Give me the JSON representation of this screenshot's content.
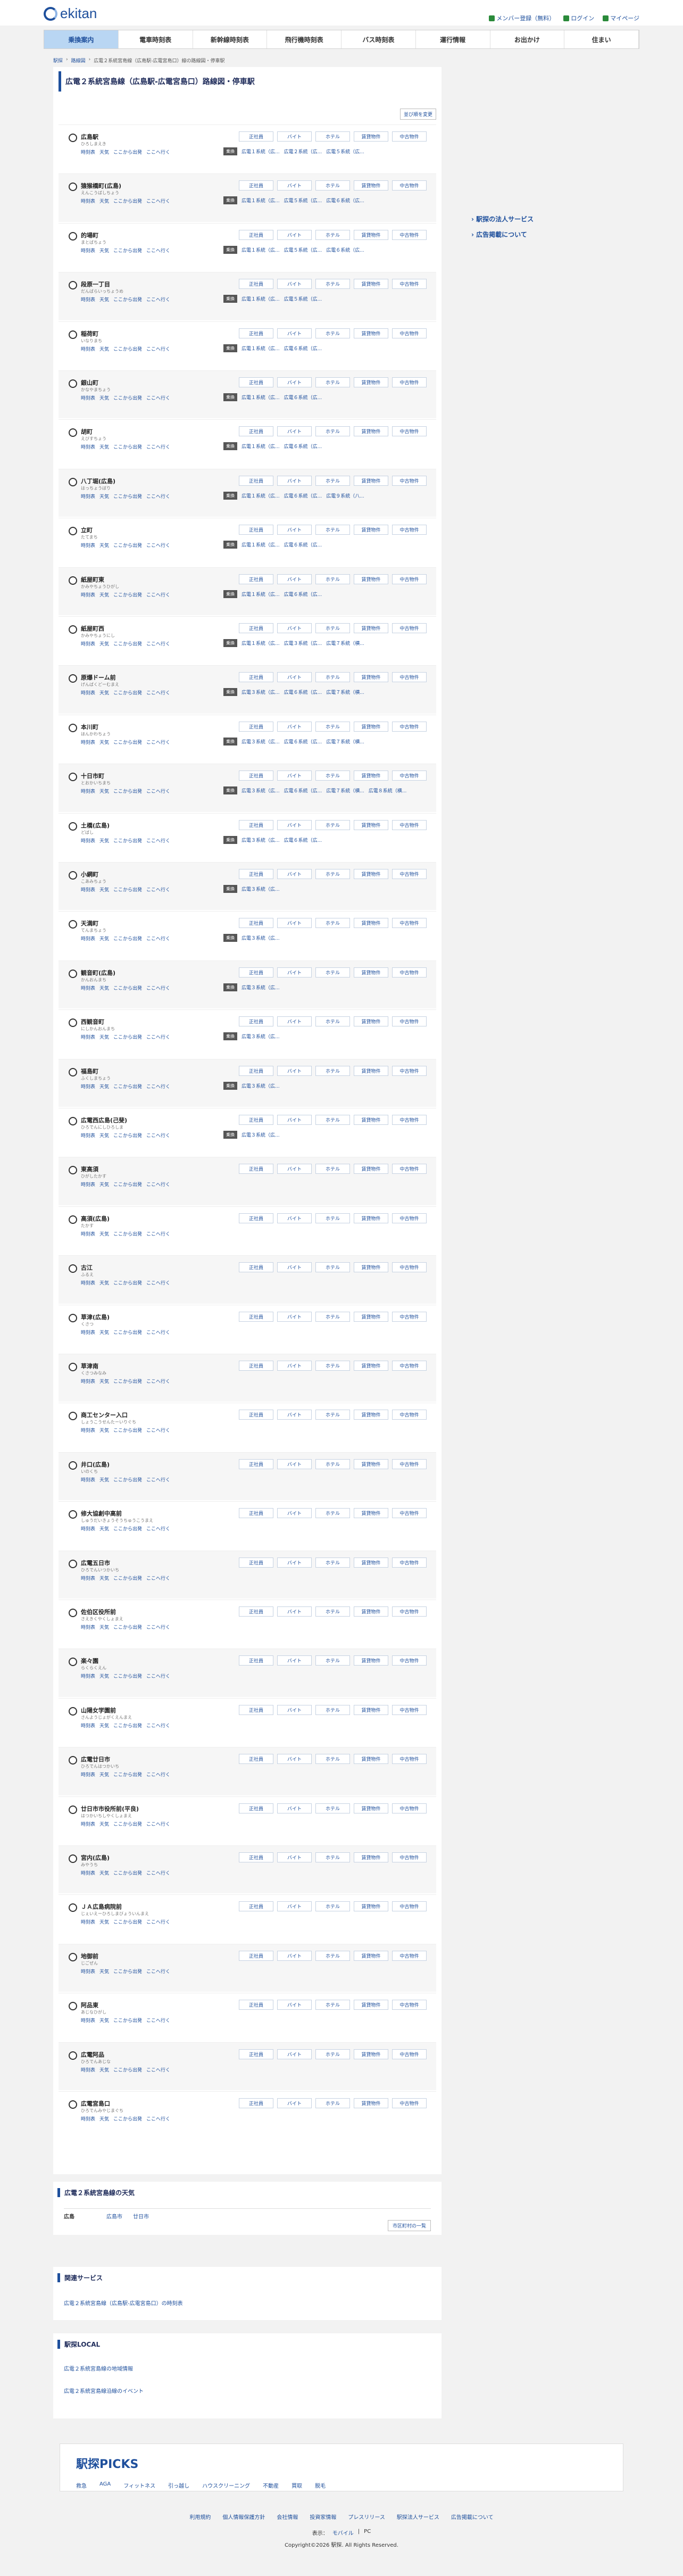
{
  "brand": "ekitan",
  "toplinks": [
    "メンバー登録（無料）",
    "ログイン",
    "マイページ"
  ],
  "nav": [
    "乗換案内",
    "電車時刻表",
    "新幹線時刻表",
    "飛行機時刻表",
    "バス時刻表",
    "運行情報",
    "お出かけ",
    "住まい"
  ],
  "breadcrumb": [
    "駅探",
    "路線図",
    "広電２系統宮島線（広島駅-広電宮島口）線の路線図・停車駅"
  ],
  "title": "広電２系統宮島線（広島駅-広電宮島口）路線図・停車駅",
  "resort_label": "並び順を変更",
  "tag_labels": [
    "正社員",
    "バイト",
    "ホテル",
    "賃貸物件",
    "中古物件"
  ],
  "station_links": [
    "時刻表",
    "天気",
    "ここから出発",
    "ここへ行く"
  ],
  "line_badge": "乗換",
  "stations": [
    {
      "name": "広島駅",
      "kana": "ひろしまえき",
      "lines": [
        "広電１系統（広...",
        "広電２系統（広...",
        "広電５系統（広..."
      ]
    },
    {
      "name": "猿猴橋町(広島)",
      "kana": "えんこうばしちょう",
      "lines": [
        "広電１系統（広...",
        "広電５系統（広...",
        "広電６系統（広..."
      ]
    },
    {
      "name": "的場町",
      "kana": "まとばちょう",
      "lines": [
        "広電１系統（広...",
        "広電５系統（広...",
        "広電６系統（広..."
      ]
    },
    {
      "name": "段原一丁目",
      "kana": "だんばらいっちょうめ",
      "lines": [
        "広電１系統（広...",
        "広電５系統（広..."
      ]
    },
    {
      "name": "稲荷町",
      "kana": "いなりまち",
      "lines": [
        "広電１系統（広...",
        "広電６系統（広..."
      ]
    },
    {
      "name": "銀山町",
      "kana": "かなやまちょう",
      "lines": [
        "広電１系統（広...",
        "広電６系統（広..."
      ]
    },
    {
      "name": "胡町",
      "kana": "えびすちょう",
      "lines": [
        "広電１系統（広...",
        "広電６系統（広..."
      ]
    },
    {
      "name": "八丁堀(広島)",
      "kana": "はっちょうぼり",
      "lines": [
        "広電１系統（広...",
        "広電６系統（広...",
        "広電９系統（八..."
      ]
    },
    {
      "name": "立町",
      "kana": "たてまち",
      "lines": [
        "広電１系統（広...",
        "広電６系統（広..."
      ]
    },
    {
      "name": "紙屋町東",
      "kana": "かみやちょうひがし",
      "lines": [
        "広電１系統（広...",
        "広電６系統（広..."
      ]
    },
    {
      "name": "紙屋町西",
      "kana": "かみやちょうにし",
      "lines": [
        "広電１系統（広...",
        "広電３系統（広...",
        "広電７系統（横..."
      ]
    },
    {
      "name": "原爆ドーム前",
      "kana": "げんばくどーむまえ",
      "lines": [
        "広電３系統（広...",
        "広電６系統（広...",
        "広電７系統（横..."
      ]
    },
    {
      "name": "本川町",
      "kana": "ほんかわちょう",
      "lines": [
        "広電３系統（広...",
        "広電６系統（広...",
        "広電７系統（横..."
      ]
    },
    {
      "name": "十日市町",
      "kana": "とおかいちまち",
      "lines": [
        "広電３系統（広...",
        "広電６系統（広...",
        "広電７系統（横...",
        "広電８系統（横..."
      ]
    },
    {
      "name": "土橋(広島)",
      "kana": "どばし",
      "lines": [
        "広電３系統（広...",
        "広電６系統（広..."
      ]
    },
    {
      "name": "小網町",
      "kana": "こあみちょう",
      "lines": [
        "広電３系統（広..."
      ]
    },
    {
      "name": "天満町",
      "kana": "てんまちょう",
      "lines": [
        "広電３系統（広..."
      ]
    },
    {
      "name": "観音町(広島)",
      "kana": "かんおんまち",
      "lines": [
        "広電３系統（広..."
      ]
    },
    {
      "name": "西観音町",
      "kana": "にしかんおんまち",
      "lines": [
        "広電３系統（広..."
      ]
    },
    {
      "name": "福島町",
      "kana": "ふくしまちょう",
      "lines": [
        "広電３系統（広..."
      ]
    },
    {
      "name": "広電西広島(己斐)",
      "kana": "ひろでんにしひろしま",
      "lines": [
        "広電３系統（広..."
      ]
    },
    {
      "name": "東高須",
      "kana": "ひがしたかす",
      "lines": []
    },
    {
      "name": "高須(広島)",
      "kana": "たかす",
      "lines": []
    },
    {
      "name": "古江",
      "kana": "ふるえ",
      "lines": []
    },
    {
      "name": "草津(広島)",
      "kana": "くさつ",
      "lines": []
    },
    {
      "name": "草津南",
      "kana": "くさつみなみ",
      "lines": []
    },
    {
      "name": "商工センター入口",
      "kana": "しょうこうせんたーいりぐち",
      "lines": []
    },
    {
      "name": "井口(広島)",
      "kana": "いのくち",
      "lines": []
    },
    {
      "name": "修大協創中高前",
      "kana": "しゅうだいきょうそうちゅうこうまえ",
      "lines": []
    },
    {
      "name": "広電五日市",
      "kana": "ひろでんいつかいち",
      "lines": []
    },
    {
      "name": "佐伯区役所前",
      "kana": "さえきくやくしょまえ",
      "lines": []
    },
    {
      "name": "楽々園",
      "kana": "らくらくえん",
      "lines": []
    },
    {
      "name": "山陽女学園前",
      "kana": "さんようじょがくえんまえ",
      "lines": []
    },
    {
      "name": "広電廿日市",
      "kana": "ひろでんはつかいち",
      "lines": []
    },
    {
      "name": "廿日市市役所前(平良)",
      "kana": "はつかいちしやくしょまえ",
      "lines": []
    },
    {
      "name": "宮内(広島)",
      "kana": "みやうち",
      "lines": []
    },
    {
      "name": "ＪＡ広島病院前",
      "kana": "じぇいえーひろしまびょういんまえ",
      "lines": []
    },
    {
      "name": "地御前",
      "kana": "じごぜん",
      "lines": []
    },
    {
      "name": "阿品東",
      "kana": "あじなひがし",
      "lines": []
    },
    {
      "name": "広電阿品",
      "kana": "ひろでんあじな",
      "lines": []
    },
    {
      "name": "広電宮島口",
      "kana": "ひろでんみやじまぐち",
      "lines": []
    }
  ],
  "side": [
    "駅探の法人サービス",
    "広告掲載について"
  ],
  "weather": {
    "title": "広電２系統宮島線の天気",
    "pref": "広島",
    "cities": [
      "広島市",
      "廿日市"
    ],
    "more": "市区町村の一覧"
  },
  "related": {
    "title": "関連サービス",
    "link": "広電２系統宮島線（広島駅-広電宮島口）の時刻表"
  },
  "local": {
    "title": "駅探LOCAL",
    "links": [
      "広電２系統宮島線の地域情報",
      "広電２系統宮島線沿線のイベント"
    ]
  },
  "picks": {
    "logo": "駅探PICKS",
    "items": [
      "救急",
      "AGA",
      "フィットネス",
      "引っ越し",
      "ハウスクリーニング",
      "不動産",
      "買取",
      "脱毛"
    ]
  },
  "footer_links": [
    "利用規約",
    "個人情報保護方針",
    "会社情報",
    "投資家情報",
    "プレスリリース",
    "駅探法人サービス",
    "広告掲載について"
  ],
  "display_label": "表示：",
  "display_opts": [
    "モバイル",
    "PC"
  ],
  "copyright": "Copyright©2026 駅探. All Rights Reserved."
}
